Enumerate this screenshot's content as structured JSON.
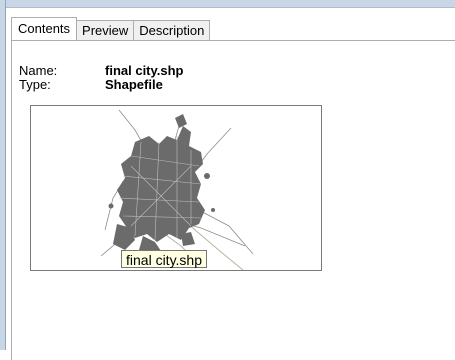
{
  "tabs": [
    {
      "label": "Contents",
      "active": true
    },
    {
      "label": "Preview",
      "active": false
    },
    {
      "label": "Description",
      "active": false
    }
  ],
  "properties": {
    "name_label": "Name:",
    "name_value": "final city.shp",
    "type_label": "Type:",
    "type_value": "Shapefile"
  },
  "thumbnail": {
    "caption": "final city.shp",
    "icon": "map-thumbnail"
  },
  "colors": {
    "tab_active_bg": "#ffffff",
    "tab_inactive_bg": "#f0f0f0",
    "caption_bg": "#ffffe1",
    "window_border": "#c8d6e6"
  }
}
